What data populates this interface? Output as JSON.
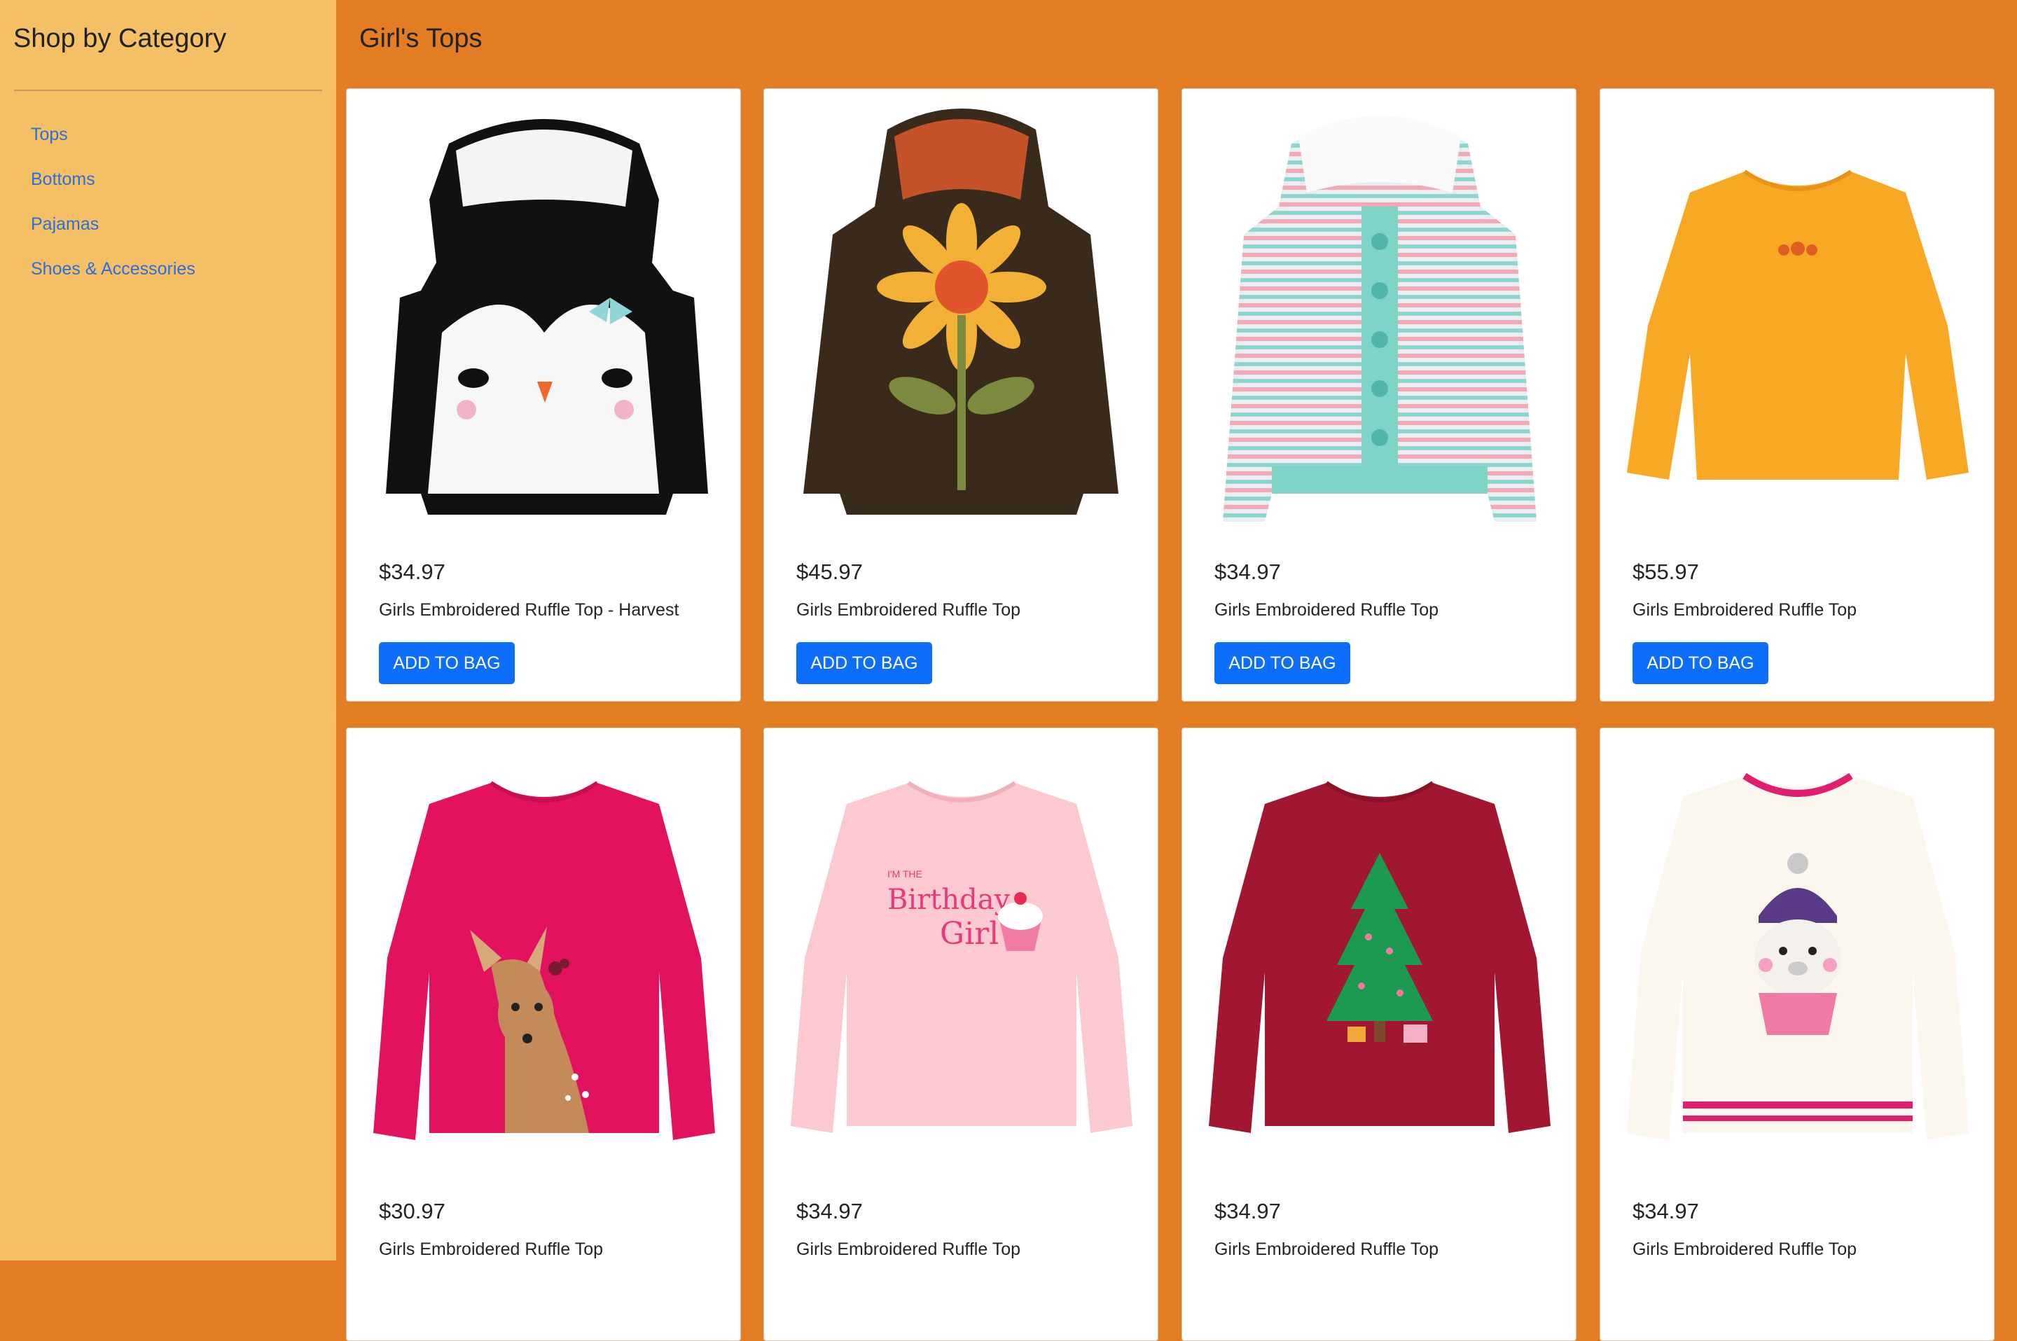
{
  "sidebar": {
    "title": "Shop by Category",
    "items": [
      {
        "label": "Tops"
      },
      {
        "label": "Bottoms"
      },
      {
        "label": "Pajamas"
      },
      {
        "label": "Shoes & Accessories"
      }
    ]
  },
  "main": {
    "title": "Girl's Tops"
  },
  "products": [
    {
      "price": "$34.97",
      "name": "Girls Embroidered Ruffle Top - Harvest",
      "button": "ADD TO BAG",
      "image": "penguin-hoodie"
    },
    {
      "price": "$45.97",
      "name": "Girls Embroidered Ruffle Top",
      "button": "ADD TO BAG",
      "image": "sunflower-hoodie"
    },
    {
      "price": "$34.97",
      "name": "Girls Embroidered Ruffle Top",
      "button": "ADD TO BAG",
      "image": "striped-cardigan"
    },
    {
      "price": "$55.97",
      "name": "Girls Embroidered Ruffle Top",
      "button": "ADD TO BAG",
      "image": "orange-ruffle-top"
    },
    {
      "price": "$30.97",
      "name": "Girls Embroidered Ruffle Top",
      "image": "deer-top"
    },
    {
      "price": "$34.97",
      "name": "Girls Embroidered Ruffle Top",
      "image": "birthday-top",
      "graphic_text": [
        "I'M THE",
        "Birthday",
        "Girl"
      ]
    },
    {
      "price": "$34.97",
      "name": "Girls Embroidered Ruffle Top",
      "image": "tree-top"
    },
    {
      "price": "$34.97",
      "name": "Girls Embroidered Ruffle Top",
      "image": "llama-sweater"
    }
  ],
  "colors": {
    "sidebar_bg": "#f5c065",
    "main_bg": "#e27d23",
    "link": "#2c6fd6",
    "button": "#0d6efd"
  }
}
